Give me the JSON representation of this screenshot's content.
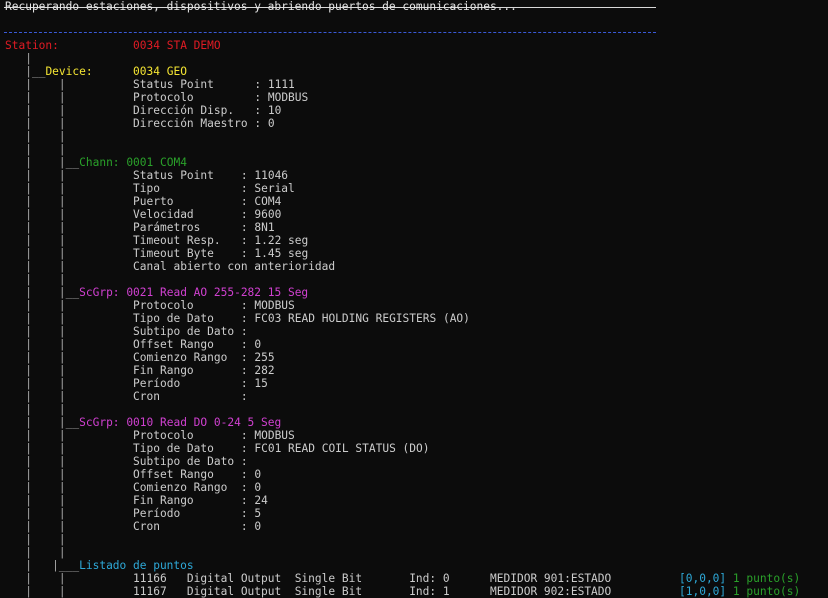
{
  "header": {
    "message": "Recuperando estaciones, dispositivos y abriendo puertos de comunicaciones..."
  },
  "station": {
    "label": "Station:",
    "value": "0034 STA DEMO"
  },
  "device": {
    "label": "Device:",
    "value": "0034 GEO",
    "props": [
      {
        "k": "Status Point     ",
        "v": ": 1111"
      },
      {
        "k": "Protocolo        ",
        "v": ": MODBUS"
      },
      {
        "k": "Dirección Disp.  ",
        "v": ": 10"
      },
      {
        "k": "Dirección Maestro",
        "v": ": 0"
      }
    ]
  },
  "channel": {
    "label": "Chann:",
    "value": "0001 COM4",
    "props": [
      {
        "k": "Status Point   ",
        "v": ": 11046"
      },
      {
        "k": "Tipo           ",
        "v": ": Serial"
      },
      {
        "k": "Puerto         ",
        "v": ": COM4"
      },
      {
        "k": "Velocidad      ",
        "v": ": 9600"
      },
      {
        "k": "Parámetros     ",
        "v": ": 8N1"
      },
      {
        "k": "Timeout Resp.  ",
        "v": ": 1.22 seg"
      },
      {
        "k": "Timeout Byte   ",
        "v": ": 1.45 seg"
      }
    ],
    "note": "Canal abierto con anterioridad"
  },
  "scan_groups": [
    {
      "label": "ScGrp:",
      "value": "0021 Read AO 255-282 15 Seg",
      "props": [
        {
          "k": "Protocolo      ",
          "v": ": MODBUS"
        },
        {
          "k": "Tipo de Dato   ",
          "v": ": FC03 READ HOLDING REGISTERS (AO)"
        },
        {
          "k": "Subtipo de Dato",
          "v": ":"
        },
        {
          "k": "Offset Rango   ",
          "v": ": 0"
        },
        {
          "k": "Comienzo Rango ",
          "v": ": 255"
        },
        {
          "k": "Fin Rango      ",
          "v": ": 282"
        },
        {
          "k": "Período        ",
          "v": ": 15"
        },
        {
          "k": "Cron           ",
          "v": ":"
        }
      ]
    },
    {
      "label": "ScGrp:",
      "value": "0010 Read DO 0-24 5 Seg",
      "props": [
        {
          "k": "Protocolo      ",
          "v": ": MODBUS"
        },
        {
          "k": "Tipo de Dato   ",
          "v": ": FC01 READ COIL STATUS (DO)"
        },
        {
          "k": "Subtipo de Dato",
          "v": ":"
        },
        {
          "k": "Offset Rango   ",
          "v": ": 0"
        },
        {
          "k": "Comienzo Rango ",
          "v": ": 0"
        },
        {
          "k": "Fin Rango      ",
          "v": ": 24"
        },
        {
          "k": "Período        ",
          "v": ": 5"
        },
        {
          "k": "Cron           ",
          "v": ": 0"
        }
      ]
    }
  ],
  "points": {
    "label": "Listado de puntos",
    "rows": [
      {
        "text": "11166   Digital Output  Single Bit       Ind: 0      MEDIDOR 901:ESTADO",
        "coords": "[0,0,0]",
        "count": "1 punto(s)"
      },
      {
        "text": "11167   Digital Output  Single Bit       Ind: 1      MEDIDOR 902:ESTADO",
        "coords": "[1,0,0]",
        "count": "1 punto(s)"
      }
    ]
  },
  "colors": {
    "background": "#0c0c0c",
    "text": "#cccccc",
    "station": "#e01b24",
    "device": "#f5e633",
    "channel": "#2aa12a",
    "scan_group": "#d040d0",
    "coords": "#2ea9d8",
    "separator": "#3a5ad8"
  }
}
